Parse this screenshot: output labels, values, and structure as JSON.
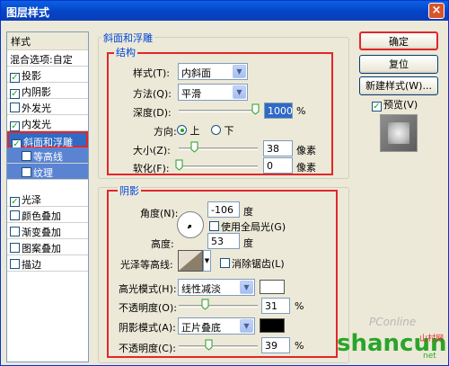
{
  "window": {
    "title": "图层样式",
    "close": "×"
  },
  "left_panel": {
    "header": "样式",
    "blend": "混合选项:自定",
    "items": [
      {
        "label": "投影",
        "checked": true
      },
      {
        "label": "内阴影",
        "checked": true
      },
      {
        "label": "外发光",
        "checked": false
      },
      {
        "label": "内发光",
        "checked": true
      },
      {
        "label": "斜面和浮雕",
        "checked": true
      },
      {
        "label": "等高线",
        "checked": false
      },
      {
        "label": "纹理",
        "checked": false
      },
      {
        "label": "光泽",
        "checked": true
      },
      {
        "label": "颜色叠加",
        "checked": false
      },
      {
        "label": "渐变叠加",
        "checked": false
      },
      {
        "label": "图案叠加",
        "checked": false
      },
      {
        "label": "描边",
        "checked": false
      }
    ],
    "check_mark": "✓"
  },
  "buttons": {
    "ok": "确定",
    "reset": "复位",
    "new_style": "新建样式(W)...",
    "preview": "预览(V)"
  },
  "bevel": {
    "title": "斜面和浮雕",
    "structure_title": "结构",
    "style_label": "样式(T):",
    "style_value": "内斜面",
    "technique_label": "方法(Q):",
    "technique_value": "平滑",
    "depth_label": "深度(D):",
    "depth_value": "1000",
    "pct": "%",
    "direction_label": "方向:",
    "dir_up": "上",
    "dir_down": "下",
    "size_label": "大小(Z):",
    "size_value": "38",
    "px": "像素",
    "soften_label": "软化(F):",
    "soften_value": "0"
  },
  "shading": {
    "title": "阴影",
    "angle_label": "角度(N):",
    "angle_value": "-106",
    "deg": "度",
    "global_light": "使用全局光(G)",
    "altitude_label": "高度:",
    "altitude_value": "53",
    "gloss_label": "光泽等高线:",
    "antialias": "消除锯齿(L)",
    "highlight_label": "高光模式(H):",
    "highlight_value": "线性减淡",
    "opacity1_label": "不透明度(O):",
    "opacity1_value": "31",
    "shadow_label": "阴影模式(A):",
    "shadow_value": "正片叠底",
    "opacity2_label": "不透明度(C):",
    "opacity2_value": "39",
    "highlight_color": "#ffffff",
    "shadow_color": "#000000"
  },
  "watermark": {
    "brand": "PConline",
    "site": "shancun",
    "sub": "山村网",
    "url": "net"
  }
}
